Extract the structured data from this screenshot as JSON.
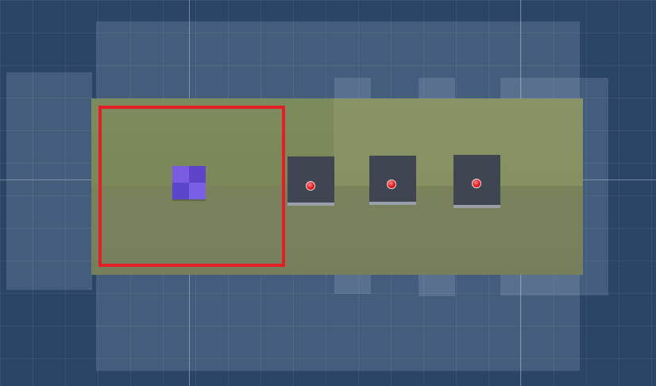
{
  "scene": {
    "background_color": "#243d5c",
    "floor_color": "#7b8758",
    "selection_color": "#e21f26",
    "player": {
      "name": "player-cube",
      "colors": [
        "#7a5be2",
        "#5d44c9"
      ]
    },
    "targets": [
      {
        "name": "target-1",
        "dot_color": "#e0191f"
      },
      {
        "name": "target-2",
        "dot_color": "#e0191f"
      },
      {
        "name": "target-3",
        "dot_color": "#e0191f"
      }
    ]
  }
}
